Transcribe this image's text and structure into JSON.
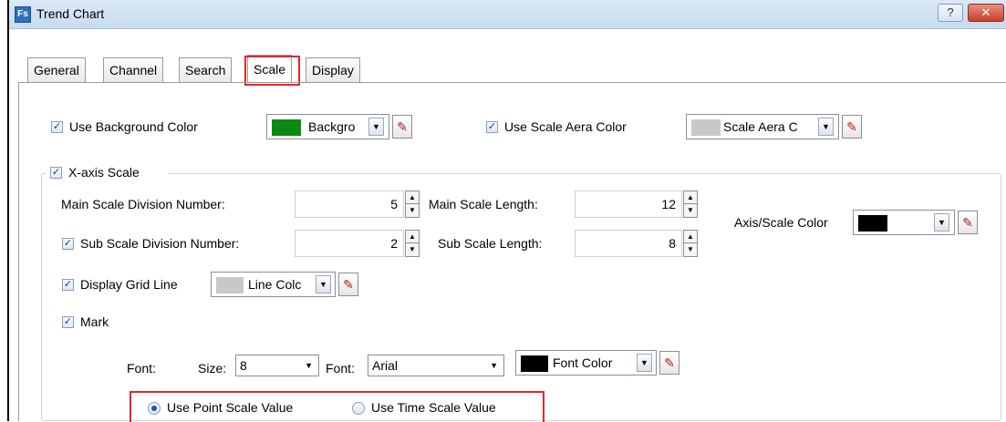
{
  "window": {
    "title": "Trend Chart",
    "app_icon_text": "Fs",
    "help_symbol": "?",
    "close_symbol": "✕"
  },
  "tabs": [
    {
      "label": "General"
    },
    {
      "label": "Channel"
    },
    {
      "label": "Search"
    },
    {
      "label": "Scale",
      "active": true
    },
    {
      "label": "Display"
    }
  ],
  "top_options": {
    "use_background_color": {
      "label": "Use Background Color",
      "checked": true,
      "combo_text": "Backgro",
      "swatch": "#0b8a12"
    },
    "use_scale_area_color": {
      "label": "Use Scale Aera Color",
      "checked": true,
      "combo_text": "Scale Aera C",
      "swatch": "#c8c8c8"
    }
  },
  "x_axis": {
    "label": "X-axis Scale",
    "checked": true,
    "main_division_label": "Main Scale Division Number:",
    "main_division_value": "5",
    "main_length_label": "Main Scale Length:",
    "main_length_value": "12",
    "sub_division_label": "Sub Scale Division Number:",
    "sub_division_checked": true,
    "sub_division_value": "2",
    "sub_length_label": "Sub Scale Length:",
    "sub_length_value": "8",
    "axis_color_label": "Axis/Scale Color",
    "axis_color_swatch": "#000000",
    "grid_line_label": "Display Grid Line",
    "grid_line_checked": true,
    "grid_line_combo_text": "Line Colc",
    "grid_line_swatch": "#c8c8c8",
    "mark_label": "Mark",
    "mark_checked": true
  },
  "font_row": {
    "font_label": "Font:",
    "size_label": "Size:",
    "size_value": "8",
    "font_name_label": "Font:",
    "font_name_value": "Arial",
    "font_color_text": "Font Color",
    "font_color_swatch": "#000000"
  },
  "scale_value_mode": {
    "point_label": "Use Point Scale Value",
    "time_label": "Use Time Scale Value",
    "selected": "point"
  },
  "symbols": {
    "check": "✓",
    "dropdown": "▼",
    "spin_up": "▲",
    "spin_down": "▼",
    "picker": "✎"
  }
}
